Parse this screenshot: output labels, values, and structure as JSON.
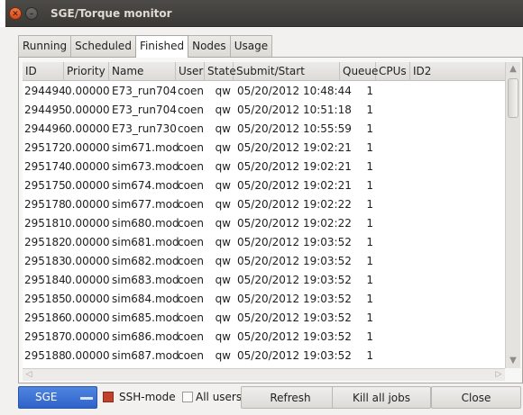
{
  "window": {
    "title": "SGE/Torque monitor"
  },
  "tabs": [
    {
      "label": "Running",
      "active": false
    },
    {
      "label": "Scheduled",
      "active": false
    },
    {
      "label": "Finished",
      "active": true
    },
    {
      "label": "Nodes",
      "active": false
    },
    {
      "label": "Usage",
      "active": false
    }
  ],
  "table": {
    "columns": [
      "ID",
      "Priority",
      "Name",
      "User",
      "State",
      "Submit/Start",
      "Queue",
      "CPUs",
      "ID2"
    ],
    "rows": [
      [
        "294494",
        "0.00000",
        "E73_run704",
        "coen",
        "qw",
        "05/20/2012 10:48:44",
        "",
        "1",
        ""
      ],
      [
        "294495",
        "0.00000",
        "E73_run704",
        "coen",
        "qw",
        "05/20/2012 10:51:18",
        "",
        "1",
        ""
      ],
      [
        "294496",
        "0.00000",
        "E73_run730",
        "coen",
        "qw",
        "05/20/2012 10:55:59",
        "",
        "1",
        ""
      ],
      [
        "295172",
        "0.00000",
        "sim671.mod",
        "coen",
        "qw",
        "05/20/2012 19:02:21",
        "",
        "1",
        ""
      ],
      [
        "295174",
        "0.00000",
        "sim673.mod",
        "coen",
        "qw",
        "05/20/2012 19:02:21",
        "",
        "1",
        ""
      ],
      [
        "295175",
        "0.00000",
        "sim674.mod",
        "coen",
        "qw",
        "05/20/2012 19:02:21",
        "",
        "1",
        ""
      ],
      [
        "295178",
        "0.00000",
        "sim677.mod",
        "coen",
        "qw",
        "05/20/2012 19:02:22",
        "",
        "1",
        ""
      ],
      [
        "295181",
        "0.00000",
        "sim680.mod",
        "coen",
        "qw",
        "05/20/2012 19:02:22",
        "",
        "1",
        ""
      ],
      [
        "295182",
        "0.00000",
        "sim681.mod",
        "coen",
        "qw",
        "05/20/2012 19:03:52",
        "",
        "1",
        ""
      ],
      [
        "295183",
        "0.00000",
        "sim682.mod",
        "coen",
        "qw",
        "05/20/2012 19:03:52",
        "",
        "1",
        ""
      ],
      [
        "295184",
        "0.00000",
        "sim683.mod",
        "coen",
        "qw",
        "05/20/2012 19:03:52",
        "",
        "1",
        ""
      ],
      [
        "295185",
        "0.00000",
        "sim684.mod",
        "coen",
        "qw",
        "05/20/2012 19:03:52",
        "",
        "1",
        ""
      ],
      [
        "295186",
        "0.00000",
        "sim685.mod",
        "coen",
        "qw",
        "05/20/2012 19:03:52",
        "",
        "1",
        ""
      ],
      [
        "295187",
        "0.00000",
        "sim686.mod",
        "coen",
        "qw",
        "05/20/2012 19:03:52",
        "",
        "1",
        ""
      ],
      [
        "295188",
        "0.00000",
        "sim687.mod",
        "coen",
        "qw",
        "05/20/2012 19:03:52",
        "",
        "1",
        ""
      ]
    ]
  },
  "bottom": {
    "scheduler": "SGE",
    "ssh_mode_label": "SSH-mode",
    "all_users_label": "All users",
    "refresh_label": "Refresh",
    "kill_label": "Kill all jobs",
    "close_label": "Close"
  },
  "colors": {
    "titlebar": "#3d3c38",
    "close_button": "#e0552a",
    "combo": "#3a6fd6",
    "ssh_checkbox": "#c2412d"
  },
  "icons": {
    "close": "close-icon",
    "minimize": "minimize-icon",
    "dropdown": "dropdown-arrow-icon"
  }
}
